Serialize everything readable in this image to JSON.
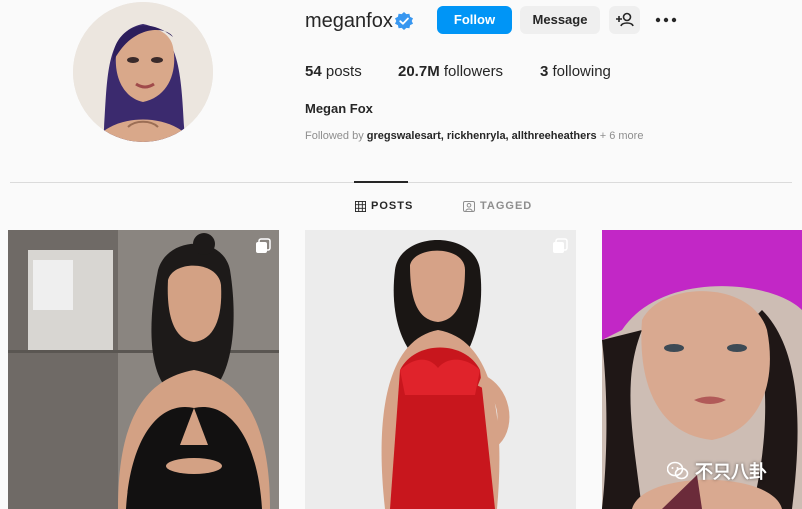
{
  "profile": {
    "username": "meganfox",
    "full_name": "Megan Fox",
    "verified": true,
    "stats": {
      "posts_count": "54",
      "posts_label": "posts",
      "followers_count": "20.7M",
      "followers_label": "followers",
      "following_count": "3",
      "following_label": "following"
    },
    "followed_by_prefix": "Followed by",
    "followed_by_names": "gregswalesart, rickhenryla, allthreeheathers",
    "followed_by_more": "+ 6 more"
  },
  "actions": {
    "follow_label": "Follow",
    "message_label": "Message",
    "add_user_icon": "add-person-icon",
    "more_icon": "more-options-icon"
  },
  "tabs": [
    {
      "label": "POSTS",
      "icon": "grid-icon",
      "active": true
    },
    {
      "label": "TAGGED",
      "icon": "tag-person-icon",
      "active": false
    }
  ],
  "posts": [
    {
      "type": "multi-photo",
      "icon": "carousel-icon"
    },
    {
      "type": "multi-photo",
      "icon": "carousel-icon"
    },
    {
      "type": "photo"
    }
  ],
  "watermark": {
    "text": "不只八卦",
    "icon": "wechat-icon"
  },
  "colors": {
    "follow_button": "#0095f6",
    "verified_badge": "#3897f0",
    "secondary_button": "#efefef",
    "muted_text": "#8e8e8e"
  }
}
